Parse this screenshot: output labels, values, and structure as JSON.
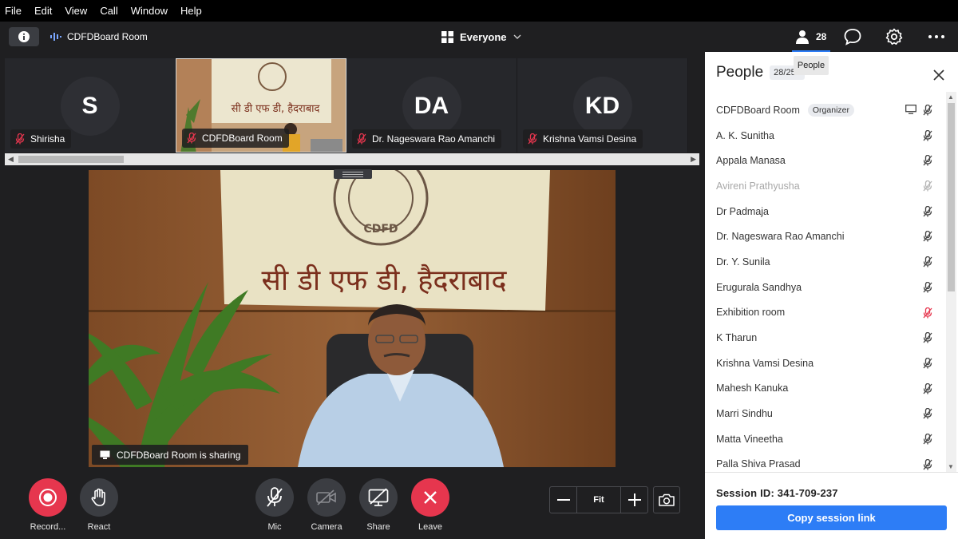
{
  "menu": [
    "File",
    "Edit",
    "View",
    "Call",
    "Window",
    "Help"
  ],
  "toolbar": {
    "room_title": "CDFDBoard Room",
    "audience": "Everyone",
    "people_count": "28",
    "people_tooltip": "People"
  },
  "thumbnails": [
    {
      "initials": "S",
      "name": "Shirisha",
      "muted": true
    },
    {
      "initials": "",
      "name": "CDFDBoard Room",
      "muted": true,
      "video": true
    },
    {
      "initials": "DA",
      "name": "Dr. Nageswara Rao Amanchi",
      "muted": true
    },
    {
      "initials": "KD",
      "name": "Krishna Vamsi Desina",
      "muted": true
    }
  ],
  "main_video": {
    "banner_text": "सी डी एफ डी, हैदराबाद",
    "logo_text": "CDFD",
    "sharing_label": "CDFDBoard Room is sharing"
  },
  "controls": {
    "record": "Record...",
    "react": "React",
    "mic": "Mic",
    "camera": "Camera",
    "share": "Share",
    "leave": "Leave",
    "zoom_fit": "Fit"
  },
  "people_panel": {
    "title": "People",
    "count": "28/251",
    "organizer_badge": "Organizer",
    "people": [
      {
        "name": "CDFDBoard Room",
        "organizer": true,
        "mic": "muted",
        "screen": true
      },
      {
        "name": "A. K. Sunitha",
        "mic": "muted"
      },
      {
        "name": "Appala Manasa",
        "mic": "muted"
      },
      {
        "name": "Avireni Prathyusha",
        "mic": "muted",
        "dim": true
      },
      {
        "name": "Dr Padmaja",
        "mic": "muted"
      },
      {
        "name": "Dr. Nageswara Rao Amanchi",
        "mic": "muted"
      },
      {
        "name": "Dr. Y. Sunila",
        "mic": "muted"
      },
      {
        "name": "Erugurala Sandhya",
        "mic": "muted"
      },
      {
        "name": "Exhibition room",
        "mic": "muted-red"
      },
      {
        "name": "K Tharun",
        "mic": "muted"
      },
      {
        "name": "Krishna Vamsi Desina",
        "mic": "muted"
      },
      {
        "name": "Mahesh Kanuka",
        "mic": "muted"
      },
      {
        "name": "Marri Sindhu",
        "mic": "muted"
      },
      {
        "name": "Matta Vineetha",
        "mic": "muted"
      },
      {
        "name": "Palla Shiva Prasad",
        "mic": "muted"
      }
    ],
    "session_id": "Session ID: 341-709-237",
    "copy_link": "Copy session link"
  },
  "colors": {
    "accent": "#2d7df6",
    "record_red": "#e6364e",
    "muted_red": "#e6364e",
    "dark_bg": "#1f1f21"
  }
}
